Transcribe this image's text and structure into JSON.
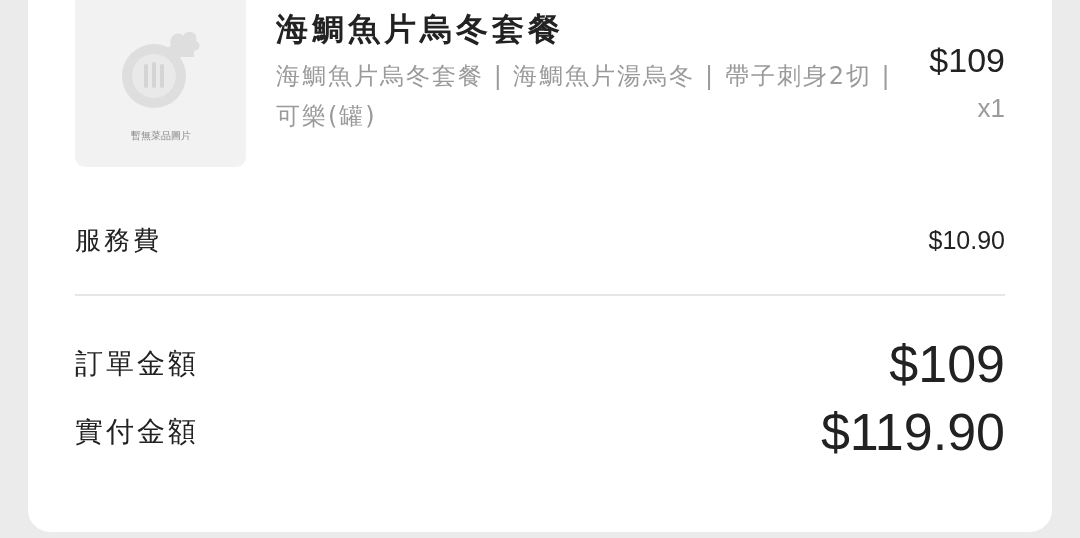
{
  "item": {
    "image": {
      "kind": "placeholder",
      "caption": "暫無菜品圖片"
    },
    "title": "海鯛魚片烏冬套餐",
    "description": "海鯛魚片烏冬套餐 | 海鯛魚片湯烏冬 | 帶子刺身2切 | 可樂(罐)",
    "price": "$109",
    "quantity": "x1"
  },
  "fees": [
    {
      "label": "服務費",
      "value": "$10.90"
    }
  ],
  "totals": [
    {
      "label": "訂單金額",
      "value": "$109"
    },
    {
      "label": "實付金額",
      "value": "$119.90"
    }
  ]
}
